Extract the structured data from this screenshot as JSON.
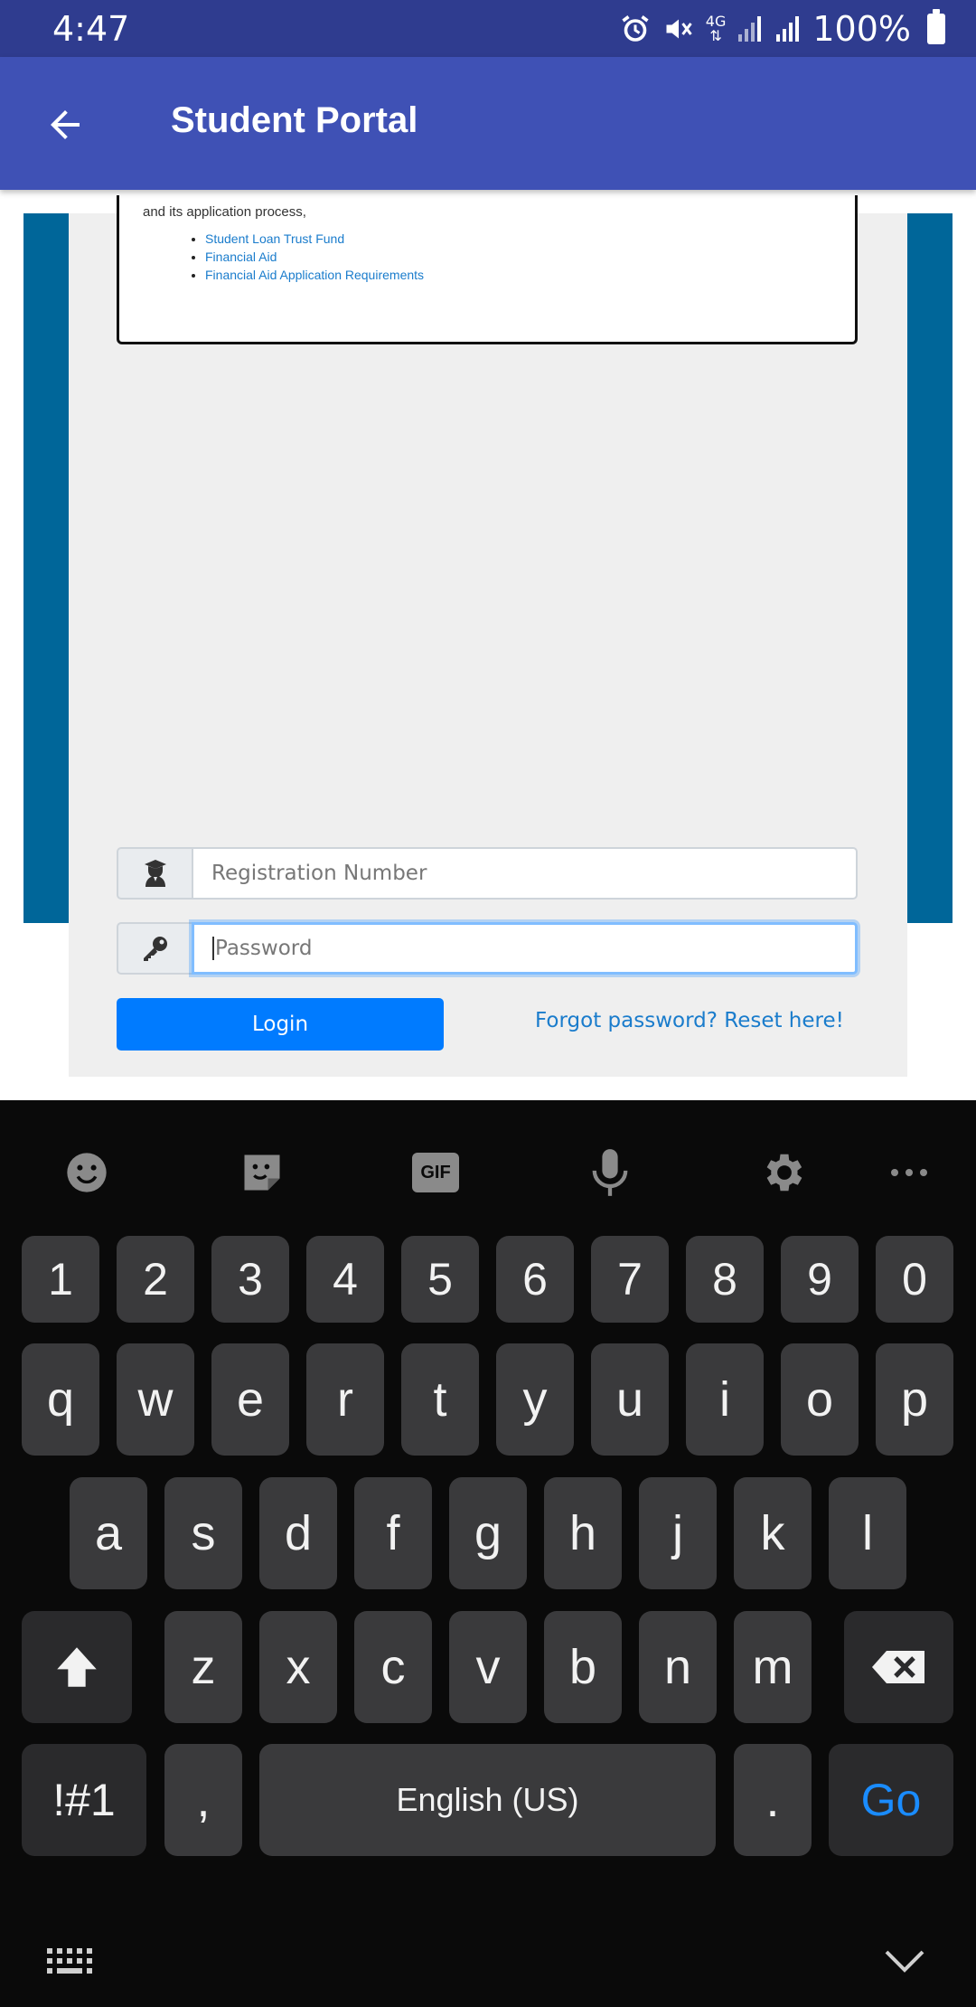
{
  "status_bar": {
    "time": "4:47",
    "network": "4G",
    "battery": "100%"
  },
  "app_bar": {
    "title": "Student Portal"
  },
  "web": {
    "info_cut_text": "and its application process,",
    "links": [
      "Student Loan Trust Fund",
      "Financial Aid",
      "Financial Aid Application Requirements"
    ],
    "registration_placeholder": "Registration Number",
    "password_placeholder": "Password",
    "login_label": "Login",
    "forgot_label": "Forgot password? Reset here!"
  },
  "keyboard": {
    "toolbar": [
      "emoji-icon",
      "sticker-icon",
      "GIF",
      "mic-icon",
      "gear-icon",
      "more-icon"
    ],
    "gif_label": "GIF",
    "row_numbers": [
      "1",
      "2",
      "3",
      "4",
      "5",
      "6",
      "7",
      "8",
      "9",
      "0"
    ],
    "row_top": [
      "q",
      "w",
      "e",
      "r",
      "t",
      "y",
      "u",
      "i",
      "o",
      "p"
    ],
    "row_mid": [
      "a",
      "s",
      "d",
      "f",
      "g",
      "h",
      "j",
      "k",
      "l"
    ],
    "row_low": [
      "z",
      "x",
      "c",
      "v",
      "b",
      "n",
      "m"
    ],
    "symbols_label": "!#1",
    "comma_label": ",",
    "space_label": "English (US)",
    "period_label": ".",
    "go_label": "Go",
    "accent_color": "#1a8cff"
  },
  "colors": {
    "status_bar": "#2f3c8f",
    "app_bar": "#3f51b5",
    "side_bars": "#006699",
    "login_button": "#007bff"
  }
}
